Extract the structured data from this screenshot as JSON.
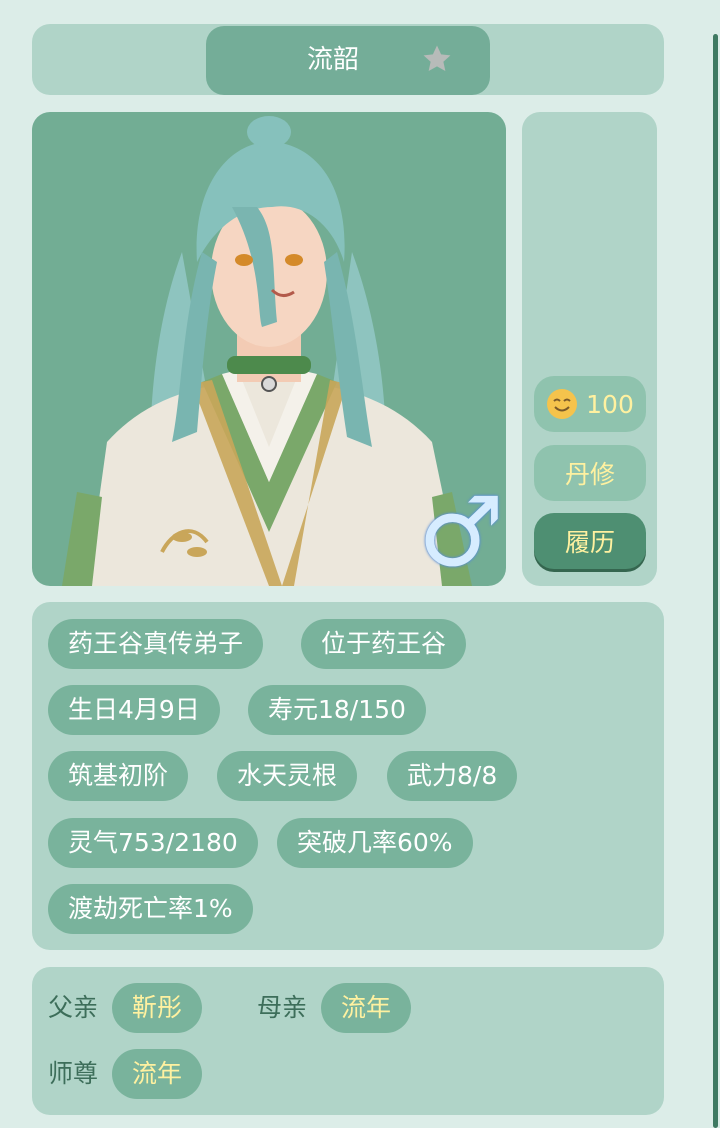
{
  "header": {
    "name": "流韶",
    "favorite_icon": "star-icon"
  },
  "portrait": {
    "gender_symbol": "♂",
    "gender_icon": "male-icon"
  },
  "side": {
    "mood_icon": "smiling-face-icon",
    "mood_value": "100",
    "occupation": "丹修",
    "history_label": "履历"
  },
  "tags": [
    "药王谷真传弟子",
    "位于药王谷",
    "生日4月9日",
    "寿元18/150",
    "筑基初阶",
    "水天灵根",
    "武力8/8",
    "灵气753/2180",
    "突破几率60%",
    "渡劫死亡率1%"
  ],
  "family": {
    "father_label": "父亲",
    "father_name": "靳彤",
    "mother_label": "母亲",
    "mother_name": "流年",
    "master_label": "师尊",
    "master_name": "流年"
  },
  "colors": {
    "background": "#dcede8",
    "panel": "#b0d4c8",
    "tag": "#79b39c",
    "accent_dark": "#4e8f72",
    "highlight_text": "#fff1a0"
  }
}
